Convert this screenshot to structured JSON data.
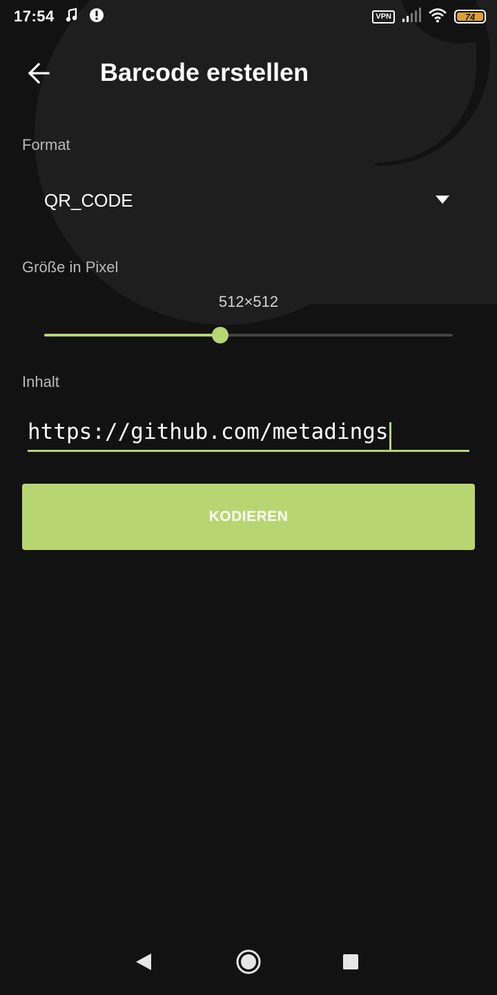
{
  "status_bar": {
    "time": "17:54",
    "vpn_label": "VPN",
    "battery_level": "74",
    "battery_color": "#e0a030",
    "icons": [
      "music-notification-icon",
      "alert-notification-icon",
      "signal-icon",
      "wifi-icon",
      "battery-icon"
    ]
  },
  "app_bar": {
    "title": "Barcode erstellen",
    "back_icon": "arrow-back-icon"
  },
  "format": {
    "label": "Format",
    "selected_value": "QR_CODE",
    "dropdown_icon": "triangle-down-icon"
  },
  "size": {
    "label": "Größe in Pixel",
    "value_text": "512×512",
    "slider_fraction": 0.43
  },
  "content": {
    "label": "Inhalt",
    "value": "https://github.com/metadings"
  },
  "encode_button": {
    "label": "KODIEREN"
  },
  "nav_bar": {
    "icons": [
      "nav-back-icon",
      "nav-home-icon",
      "nav-recents-icon"
    ]
  },
  "colors": {
    "background": "#121212",
    "accent": "#b7d672",
    "label": "#b9b9b9"
  }
}
